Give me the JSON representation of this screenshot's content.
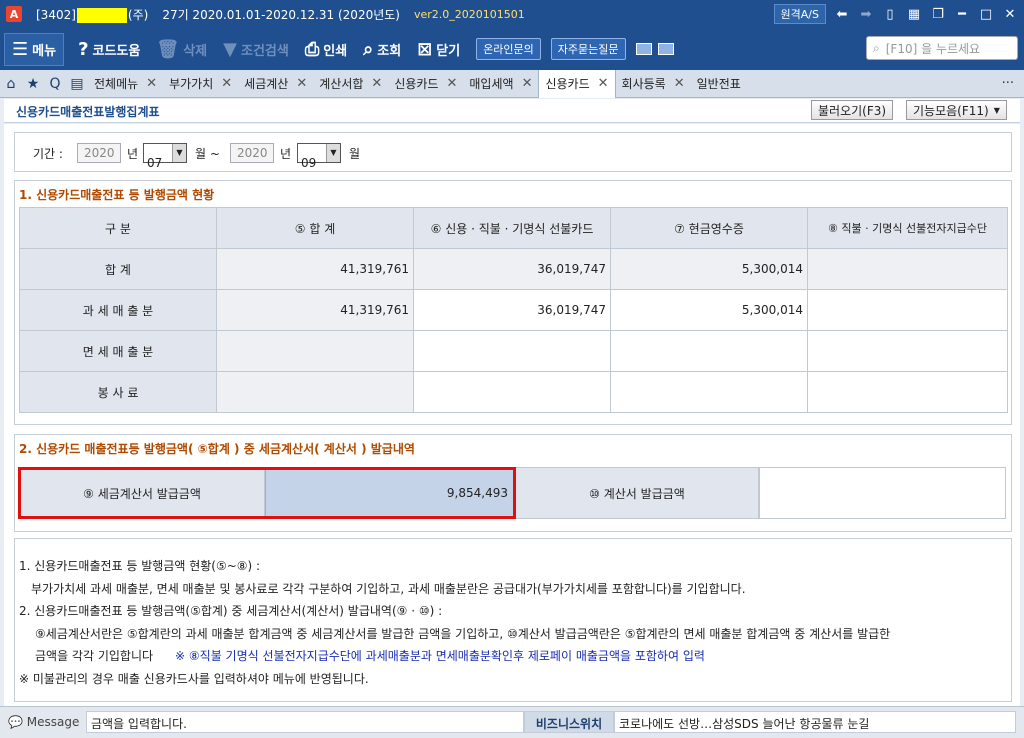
{
  "titlebar": {
    "app_icon": "A",
    "company_code": "[3402]",
    "company_suffix": "(주)",
    "period": "27기 2020.01.01-2020.12.31 (2020년도)",
    "version": "ver2.0_2020101501",
    "remote_as": "원격A/S"
  },
  "toolbar": {
    "menu": "메뉴",
    "code_help": "코드도움",
    "delete": "삭제",
    "condition_search": "조건검색",
    "print": "인쇄",
    "lookup": "조회",
    "close": "닫기",
    "online_inquiry": "온라인문의",
    "faq": "자주묻는질문",
    "search_placeholder": "[F10] 을 누르세요"
  },
  "tabs": [
    {
      "label": "전체메뉴"
    },
    {
      "label": "부가가치"
    },
    {
      "label": "세금계산"
    },
    {
      "label": "계산서합"
    },
    {
      "label": "신용카드"
    },
    {
      "label": "매입세액"
    },
    {
      "label": "신용카드"
    },
    {
      "label": "회사등록"
    },
    {
      "label": "일반전표"
    }
  ],
  "page": {
    "title": "신용카드매출전표발행집계표",
    "load_button": "불러오기(F3)",
    "functions_button": "기능모음(F11)"
  },
  "period_row": {
    "label": "기간 :",
    "start_year": "2020",
    "year_unit_1": "년",
    "start_month": "07",
    "month_tilde": "월 ~",
    "end_year": "2020",
    "year_unit_2": "년",
    "end_month": "09",
    "month_unit": "월"
  },
  "section1": {
    "title": "1. 신용카드매출전표 등 발행금액 현황",
    "headers": [
      "구          분",
      "⑤ 합            계",
      "⑥ 신용 · 직불 · 기명식 선불카드",
      "⑦ 현금영수증",
      "⑧ 직불 · 기명식 선불전자지급수단"
    ],
    "rows": [
      {
        "label": "합        계",
        "total": "41,319,761",
        "card": "36,019,747",
        "cash": "5,300,014",
        "epay": ""
      },
      {
        "label": "과 세 매 출 분",
        "total": "41,319,761",
        "card": "36,019,747",
        "cash": "5,300,014",
        "epay": ""
      },
      {
        "label": "면 세 매 출 분",
        "total": "",
        "card": "",
        "cash": "",
        "epay": ""
      },
      {
        "label": "봉     사     료",
        "total": "",
        "card": "",
        "cash": "",
        "epay": ""
      }
    ]
  },
  "section2": {
    "title": "2. 신용카드 매출전표등 발행금액( ⑤합계 ) 중 세금계산서( 계산서 ) 발급내역",
    "tax_invoice_label": "⑨ 세금계산서 발급금액",
    "tax_invoice_value": "9,854,493",
    "invoice_label": "⑩ 계산서 발급금액",
    "invoice_value": ""
  },
  "notes": {
    "line1": "1. 신용카드매출전표 등 발행금액 현황(⑤~⑧) :",
    "line2": "부가가치세 과세 매출분, 면세 매출분 및 봉사료로 각각 구분하여 기입하고, 과세 매출분란은 공급대가(부가가치세를 포함합니다)를 기입합니다.",
    "line3": "2. 신용카드매출전표 등 발행금액(⑤합계) 중 세금계산서(계산서) 발급내역(⑨ · ⑩) :",
    "line4": "⑨세금계산서란은 ⑤합계란의 과세 매출분 합계금액 중 세금계산서를 발급한 금액을 기입하고, ⑩계산서 발급금액란은 ⑤합계란의 면세 매출분 합계금액 중 계산서를 발급한",
    "line5a": "금액을 각각 기입합니다",
    "line5b": "※ ⑧직불 기명식 선불전자지급수단에 과세매출분과 면세매출분확인후 제로페이 매출금액을 포함하여 입력",
    "line6": "※ 미불관리의 경우 매출 신용카드사를 입력하셔야 메뉴에 반영됩니다."
  },
  "statusbar": {
    "message_label": "Message",
    "message_text": "금액을 입력합니다.",
    "biz_label": "비즈니스위치",
    "news_text": "코로나에도 선방…삼성SDS 늘어난 항공물류 눈길"
  }
}
